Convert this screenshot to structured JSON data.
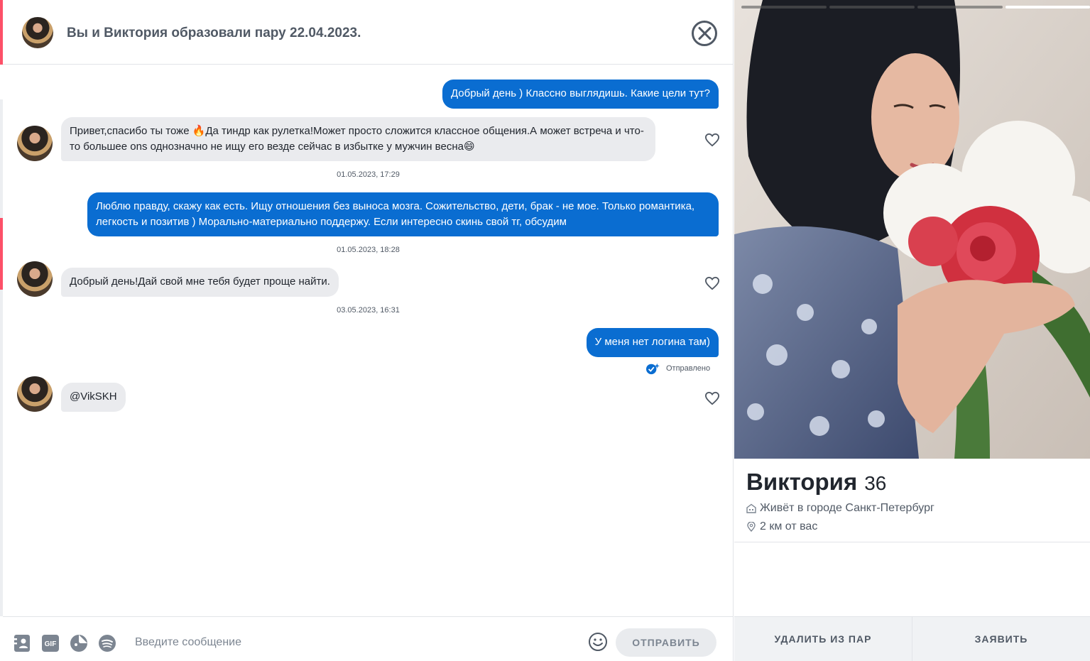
{
  "header": {
    "title": "Вы и Виктория образовали пару 22.04.2023."
  },
  "messages": [
    {
      "dir": "out",
      "text": "Добрый день ) Классно выглядишь. Какие цели тут?"
    },
    {
      "dir": "in",
      "text": "Привет,спасибо ты тоже 🔥Да тиндр как рулетка!Может просто сложится классное общения.А может встреча и что-то большее ons однозначно не ищу его везде сейчас в избытке у мужчин весна😄"
    },
    {
      "dir": "out",
      "text": "Люблю правду, скажу как есть. Ищу отношения без выноса мозга. Сожительство, дети, брак - не мое. Только романтика, легкость и позитив ) Морально-материально поддержу. Если интересно скинь свой тг, обсудим"
    },
    {
      "dir": "in",
      "text": "Добрый день!Дай свой мне тебя будет проще найти."
    },
    {
      "dir": "out",
      "text": "У меня нет логина там)"
    },
    {
      "dir": "in",
      "text": "@VikSKH"
    }
  ],
  "timestamps": [
    "01.05.2023, 17:29",
    "01.05.2023, 18:28",
    "03.05.2023, 16:31"
  ],
  "sent_status": "Отправлено",
  "composer": {
    "placeholder": "Введите сообщение",
    "send_label": "ОТПРАВИТЬ",
    "tools": [
      "contact-card-icon",
      "gif-icon",
      "sticker-icon",
      "spotify-icon"
    ]
  },
  "profile": {
    "name": "Виктория",
    "age": "36",
    "city": "Живёт в городе Санкт-Петербург",
    "distance": "2 км от вас",
    "photo_count": 4,
    "active_photo_index": 3,
    "unmatch_label": "УДАЛИТЬ ИЗ ПАР",
    "report_label": "ЗАЯВИТЬ"
  },
  "colors": {
    "accent": "#fd5068",
    "outgoing_bubble": "#0a6dd1",
    "incoming_bubble": "#eaebee"
  }
}
